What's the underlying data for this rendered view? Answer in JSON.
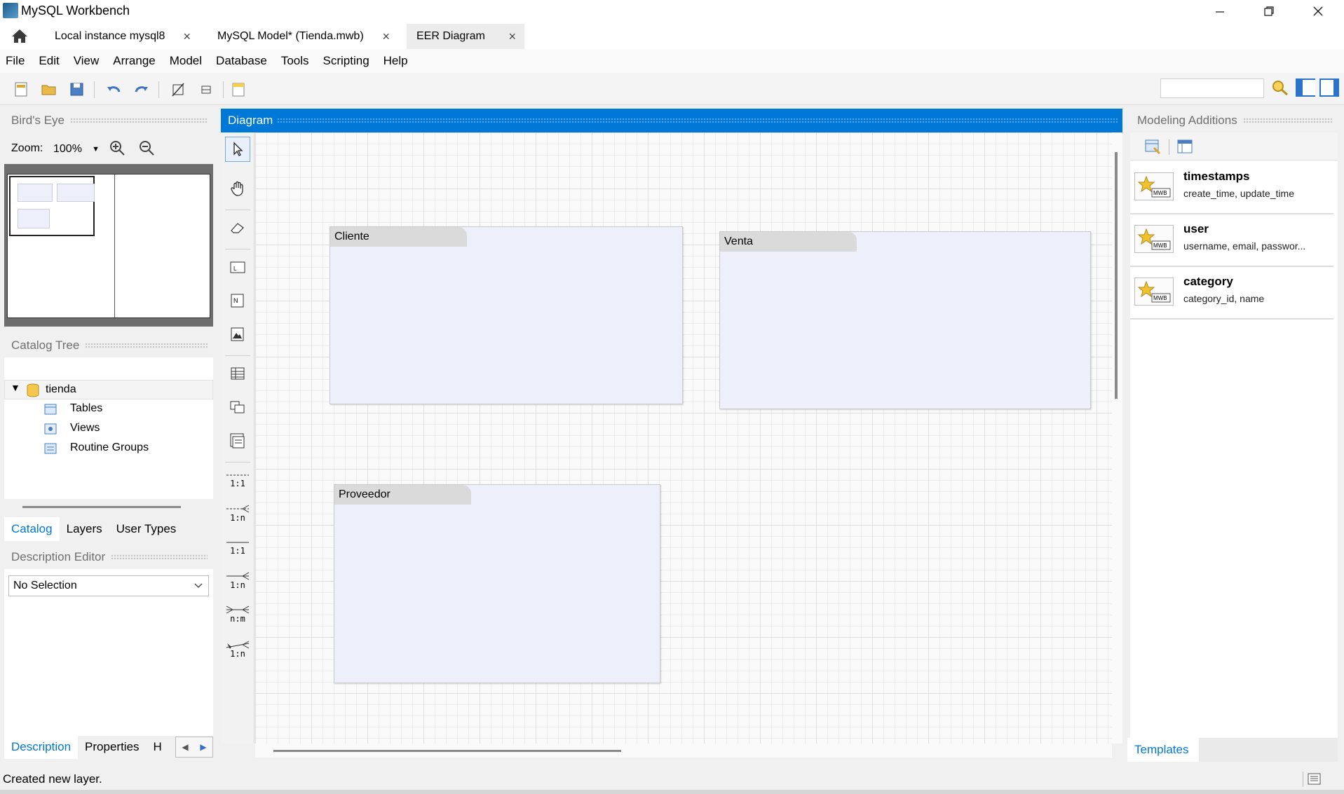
{
  "window": {
    "title": "MySQL Workbench"
  },
  "tabs": [
    {
      "label": "Local instance mysql8"
    },
    {
      "label": "MySQL Model* (Tienda.mwb)"
    },
    {
      "label": "EER Diagram"
    }
  ],
  "menu": [
    "File",
    "Edit",
    "View",
    "Arrange",
    "Model",
    "Database",
    "Tools",
    "Scripting",
    "Help"
  ],
  "birds_eye": {
    "title": "Bird's Eye",
    "zoom_label": "Zoom:",
    "zoom_value": "100%"
  },
  "catalog_tree": {
    "title": "Catalog Tree",
    "schema": "tienda",
    "items": [
      "Tables",
      "Views",
      "Routine Groups"
    ]
  },
  "left_tabs": [
    "Catalog",
    "Layers",
    "User Types"
  ],
  "description_editor": {
    "title": "Description Editor",
    "selection": "No Selection"
  },
  "bottom_left_tabs": [
    "Description",
    "Properties",
    "H"
  ],
  "diagram": {
    "title": "Diagram",
    "layers": [
      {
        "name": "Cliente"
      },
      {
        "name": "Venta"
      },
      {
        "name": "Proveedor"
      }
    ]
  },
  "palette_labels": {
    "rel_11_id": "1:1",
    "rel_1n_id": "1:n",
    "rel_11": "1:1",
    "rel_1n": "1:n",
    "rel_nm": "n:m",
    "rel_1n_existing": "1:n"
  },
  "modeling_additions": {
    "title": "Modeling Additions",
    "items": [
      {
        "name": "timestamps",
        "desc": "create_time, update_time"
      },
      {
        "name": "user",
        "desc": "username, email, passwor..."
      },
      {
        "name": "category",
        "desc": "category_id, name"
      }
    ],
    "tab": "Templates"
  },
  "status": {
    "message": "Created new layer."
  },
  "colors": {
    "accent": "#0078d7",
    "layer_fill": "#edeffb",
    "layer_title": "#dadada"
  }
}
